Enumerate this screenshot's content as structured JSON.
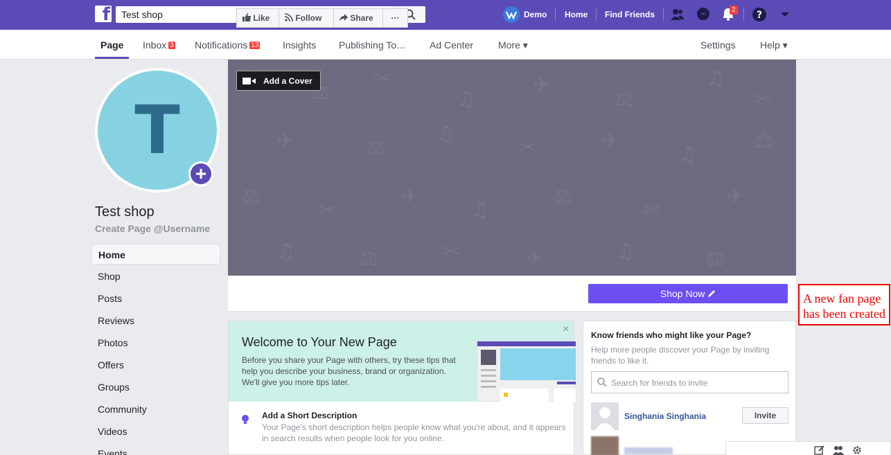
{
  "topbar": {
    "search_value": "Test shop",
    "user_name": "Demo",
    "home_label": "Home",
    "find_friends_label": "Find Friends",
    "notifications_count": "2"
  },
  "pagenav": {
    "page": "Page",
    "inbox": "Inbox",
    "inbox_count": "3",
    "notifications": "Notifications",
    "notifications_count": "13",
    "insights": "Insights",
    "publishing": "Publishing To…",
    "ad_center": "Ad Center",
    "more": "More ▾",
    "settings": "Settings",
    "help": "Help ▾"
  },
  "profile": {
    "initial": "T",
    "name": "Test shop",
    "username_link": "Create Page @Username"
  },
  "leftnav": [
    "Home",
    "Shop",
    "Posts",
    "Reviews",
    "Photos",
    "Offers",
    "Groups",
    "Community",
    "Videos",
    "Events"
  ],
  "cover": {
    "add_cover_label": "Add a Cover"
  },
  "actions": {
    "like": "Like",
    "follow": "Follow",
    "share": "Share",
    "more": "···",
    "shop_now": "Shop Now"
  },
  "welcome": {
    "title": "Welcome to Your New Page",
    "desc": "Before you share your Page with others, try these tips that help you describe your business, brand or organization. We'll give you more tips later.",
    "close": "×",
    "short_title": "Add a Short Description",
    "short_desc": "Your Page's short description helps people know what you're about, and it appears in search results when people look for you online."
  },
  "invite": {
    "title": "Know friends who might like your Page?",
    "desc": "Help more people discover your Page by inviting friends to like it.",
    "search_placeholder": "Search for friends to invite",
    "friend_name": "Singhania Singhania",
    "invite_button": "Invite"
  },
  "annotation": {
    "text": "A new fan page has been created"
  },
  "colors": {
    "brand": "#5b4bb7",
    "shop_now": "#6c4ef2",
    "badge": "#fa3e3e",
    "annotation": "#e00000"
  }
}
